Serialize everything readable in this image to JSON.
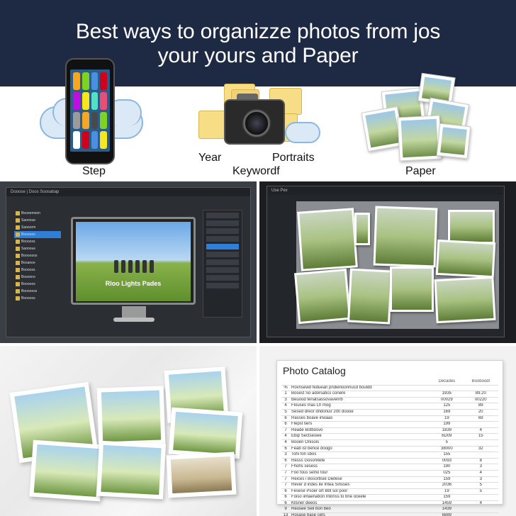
{
  "header": {
    "title_line1": "Best ways to organizze photos from jos",
    "title_line2": "your yours and Paper"
  },
  "icons": {
    "cloud": "cloud-icon",
    "phone": "smartphone-icon",
    "folder": "folder-icon",
    "camera": "camera-icon"
  },
  "labels": {
    "step": "Step",
    "year": "Year",
    "portraits": "Portraits",
    "keyword": "Keywordf",
    "paper": "Paper"
  },
  "app_left": {
    "window_title": "Dooose | Doos Soosabap",
    "monitor_caption": "Rloo Lights Pades",
    "sidebar_items": [
      "Beooemonn",
      "Saonoue",
      "Saooorm",
      "Booooos",
      "Booooss",
      "Saonoue",
      "Boooooos",
      "Bosanoe",
      "Booooss",
      "Bosoono",
      "Booooos",
      "Boooooss",
      "Booooos"
    ]
  },
  "app_right": {
    "window_title": "Use Pex"
  },
  "catalog": {
    "title": "Photo Catalog",
    "headers": [
      "",
      "",
      "Decades",
      "Booboodl"
    ],
    "rows": [
      [
        "%",
        "Rovnsewd feduean pndienoonnucd bouldd",
        "",
        ""
      ],
      [
        "1",
        "Bosest So adorsatics conere",
        "1935",
        "89.20"
      ],
      [
        "3",
        "Beuood tenatsassovaverirb",
        "00029",
        "00220"
      ],
      [
        "4",
        "Flouses Inas Lh mog",
        "125",
        "89"
      ],
      [
        "5",
        "Sesed dreor dndonuir 200 doooe",
        "169",
        "20"
      ],
      [
        "6",
        "Rasses boave inwaas",
        "19",
        "69"
      ],
      [
        "6",
        "Flepst tiers",
        "199",
        ""
      ],
      [
        "7",
        "Reade Botbosvo",
        "1839",
        "4"
      ],
      [
        "4",
        "Ebip Sectseswe",
        "6D09",
        "15"
      ],
      [
        "4",
        "Booen Onisois",
        "5",
        ""
      ],
      [
        "6",
        "Feab ist bence doogo",
        "38000",
        "32"
      ],
      [
        "3",
        "Tohi fon sbos",
        "155",
        ""
      ],
      [
        "6",
        "Resss Gosonitete",
        "0093",
        "8"
      ],
      [
        "7",
        "Fhohs sesess",
        "190",
        "3"
      ],
      [
        "7",
        "Foo fous selno tour",
        "025",
        "4"
      ],
      [
        "7",
        "Reices i Bosorbsie Dietese",
        "159",
        "3"
      ],
      [
        "7",
        "Rever d indes ile Intea Sinsses",
        "2036",
        "5"
      ],
      [
        "6",
        "Fesese Psoer ort Bbt sol poor",
        "19",
        "5"
      ],
      [
        "6",
        "Foiso iintaenation Inloriss to bne oceele",
        "159",
        ""
      ],
      [
        "6",
        "Kllsner deeos",
        "1459",
        "4"
      ],
      [
        "9",
        "Reusee Seli bon beo",
        "1439",
        ""
      ],
      [
        "13",
        "Rosase base cets",
        "6889",
        ""
      ]
    ]
  }
}
